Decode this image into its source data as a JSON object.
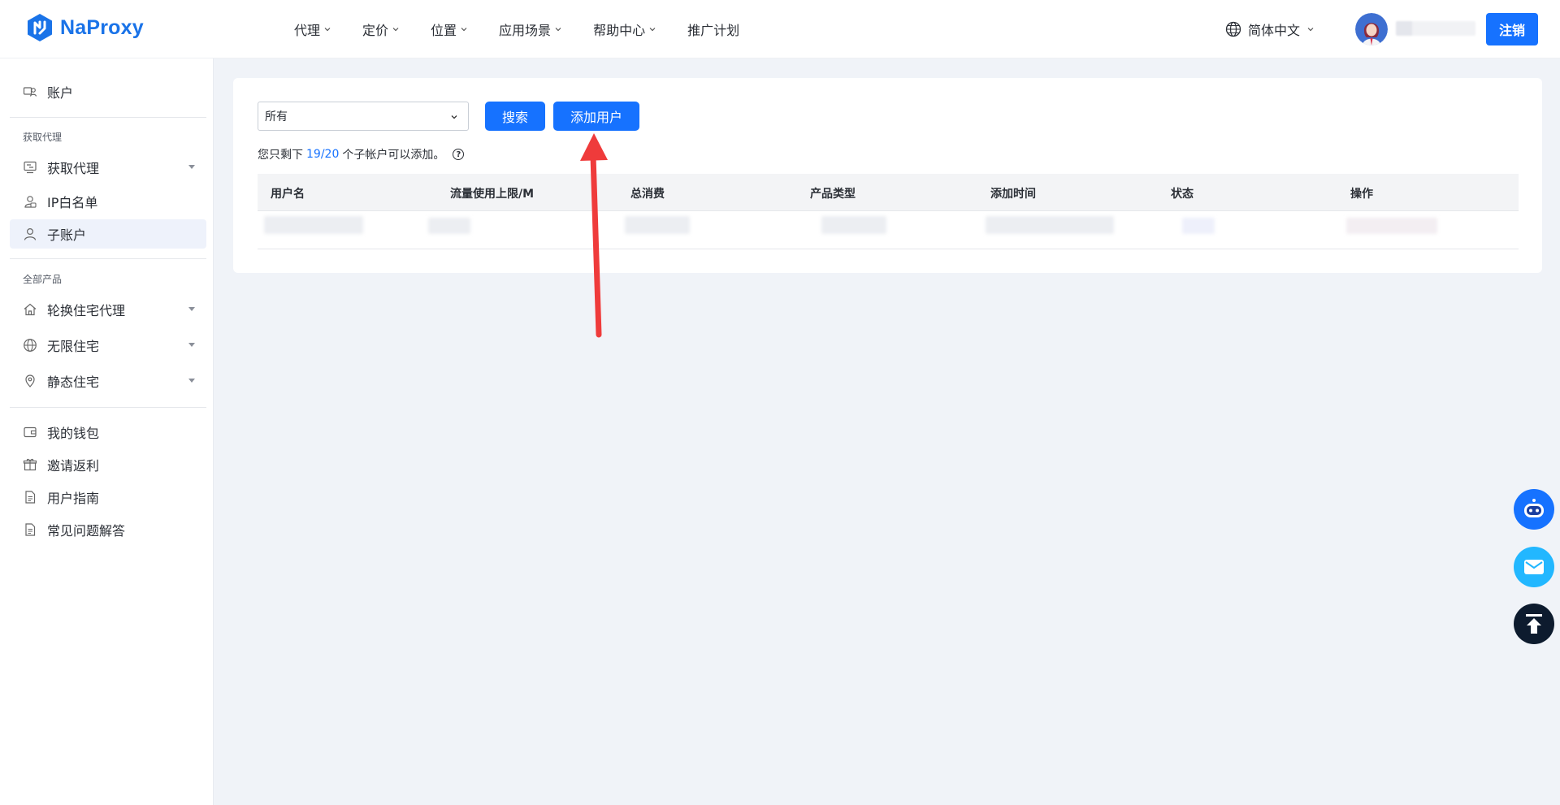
{
  "header": {
    "logo_text": "NaProxy",
    "nav": [
      {
        "label": "代理",
        "has_dropdown": true
      },
      {
        "label": "定价",
        "has_dropdown": true
      },
      {
        "label": "位置",
        "has_dropdown": true
      },
      {
        "label": "应用场景",
        "has_dropdown": true
      },
      {
        "label": "帮助中心",
        "has_dropdown": true
      },
      {
        "label": "推广计划",
        "has_dropdown": false
      }
    ],
    "language": "简体中文",
    "logout_label": "注销"
  },
  "sidebar": {
    "account": "账户",
    "section_get_proxy": "获取代理",
    "items_get": [
      {
        "label": "获取代理",
        "icon": "proxy-icon"
      },
      {
        "label": "IP白名单",
        "icon": "whitelist-icon"
      },
      {
        "label": "子账户",
        "icon": "user-icon"
      }
    ],
    "section_products": "全部产品",
    "items_products": [
      {
        "label": "轮换住宅代理",
        "icon": "home-icon"
      },
      {
        "label": "无限住宅",
        "icon": "globe-icon"
      },
      {
        "label": "静态住宅",
        "icon": "location-icon"
      }
    ],
    "items_other": [
      {
        "label": "我的钱包",
        "icon": "wallet-icon"
      },
      {
        "label": "邀请返利",
        "icon": "gift-icon"
      },
      {
        "label": "用户指南",
        "icon": "document-icon"
      },
      {
        "label": "常见问题解答",
        "icon": "faq-icon"
      }
    ]
  },
  "main": {
    "filter_value": "所有",
    "search_label": "搜索",
    "add_user_label": "添加用户",
    "hint_prefix": "您只剩下",
    "hint_count": "19/20",
    "hint_suffix": "个子帐户可以添加。",
    "columns": [
      "用户名",
      "流量使用上限/M",
      "总消费",
      "产品类型",
      "添加时间",
      "状态",
      "操作"
    ]
  },
  "colors": {
    "primary": "#1672ff",
    "annotation_arrow": "#ef3b3b",
    "mail_button": "#22b7ff",
    "top_button": "#0d1b2e"
  }
}
